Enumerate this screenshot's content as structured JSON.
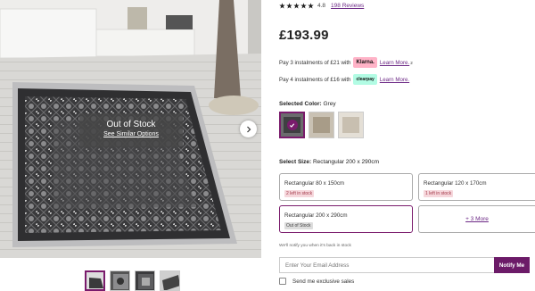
{
  "gallery": {
    "overlay_title": "Out of Stock",
    "overlay_link": "See Similar Options"
  },
  "rating": {
    "value": 4.8,
    "value_label": "4.8",
    "reviews_label": "198 Reviews",
    "stars": 5
  },
  "price": "£193.99",
  "payments": {
    "klarna": {
      "prefix": "Pay 3 instalments of £21 with",
      "badge": "Klarna.",
      "link": "Learn More.",
      "sup": "2"
    },
    "clearpay": {
      "prefix": "Pay 4 instalments of £16 with",
      "badge": "clearpay",
      "link": "Learn More."
    }
  },
  "color": {
    "label": "Selected Color:",
    "value": "Grey",
    "swatches": [
      "grey-swatch",
      "beige-swatch",
      "cream-swatch"
    ]
  },
  "size": {
    "label": "Select Size:",
    "value": "Rectangular 200 x 290cm",
    "options": [
      {
        "name": "Rectangular 80 x 150cm",
        "tag": "2 left in stock"
      },
      {
        "name": "Rectangular 120 x 170cm",
        "tag": "1 left in stock"
      },
      {
        "name": "Rectangular 200 x 290cm",
        "tag": "Out of Stock"
      }
    ],
    "more": "+ 3 More"
  },
  "notify": {
    "note": "We'll notify you when it's back in stock",
    "placeholder": "Enter Your Email Address",
    "button": "Notify Me",
    "sales": "Send me exclusive sales"
  },
  "colors": {
    "accent": "#6c1b68",
    "link": "#6d2a86",
    "klarna": "#ffb3c7",
    "clearpay": "#b2fce4"
  }
}
